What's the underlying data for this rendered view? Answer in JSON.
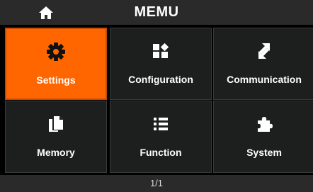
{
  "header": {
    "title": "MEMU",
    "home_icon": "home-icon"
  },
  "tiles": [
    {
      "label": "Settings",
      "icon": "gear-icon",
      "active": true
    },
    {
      "label": "Configuration",
      "icon": "configuration-icon",
      "active": false
    },
    {
      "label": "Communication",
      "icon": "communication-icon",
      "active": false
    },
    {
      "label": "Memory",
      "icon": "memory-icon",
      "active": false
    },
    {
      "label": "Function",
      "icon": "list-icon",
      "active": false
    },
    {
      "label": "System",
      "icon": "puzzle-icon",
      "active": false
    }
  ],
  "footer": {
    "page": "1/1"
  },
  "colors": {
    "accent": "#ff6600",
    "accent_border": "#c84a00",
    "tile_bg": "#1d1f1f",
    "bar_bg": "#2a2a2a"
  }
}
